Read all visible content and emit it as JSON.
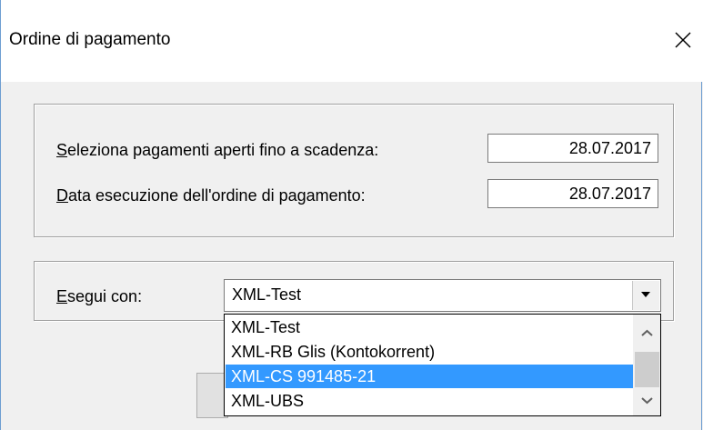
{
  "window": {
    "title": "Ordine di pagamento"
  },
  "group1": {
    "row1": {
      "label_accel": "S",
      "label_rest": "eleziona pagamenti aperti fino a scadenza:",
      "value": "28.07.2017"
    },
    "row2": {
      "label_accel": "D",
      "label_rest": "ata esecuzione dell'ordine di pagamento:",
      "value": "28.07.2017"
    }
  },
  "group2": {
    "label_accel": "E",
    "label_rest": "segui con:",
    "combo_value": "XML-Test",
    "options": [
      "XML-Test",
      "XML-RB Glis (Kontokorrent)",
      "XML-CS 991485-21",
      "XML-UBS"
    ],
    "selected_index": 2
  },
  "colors": {
    "selection": "#3399ff",
    "background": "#f0f0f0"
  },
  "icons": {
    "close": "close-icon",
    "dropdown": "chevron-down-icon",
    "scroll_up": "scroll-up-icon",
    "scroll_down": "scroll-down-icon"
  }
}
